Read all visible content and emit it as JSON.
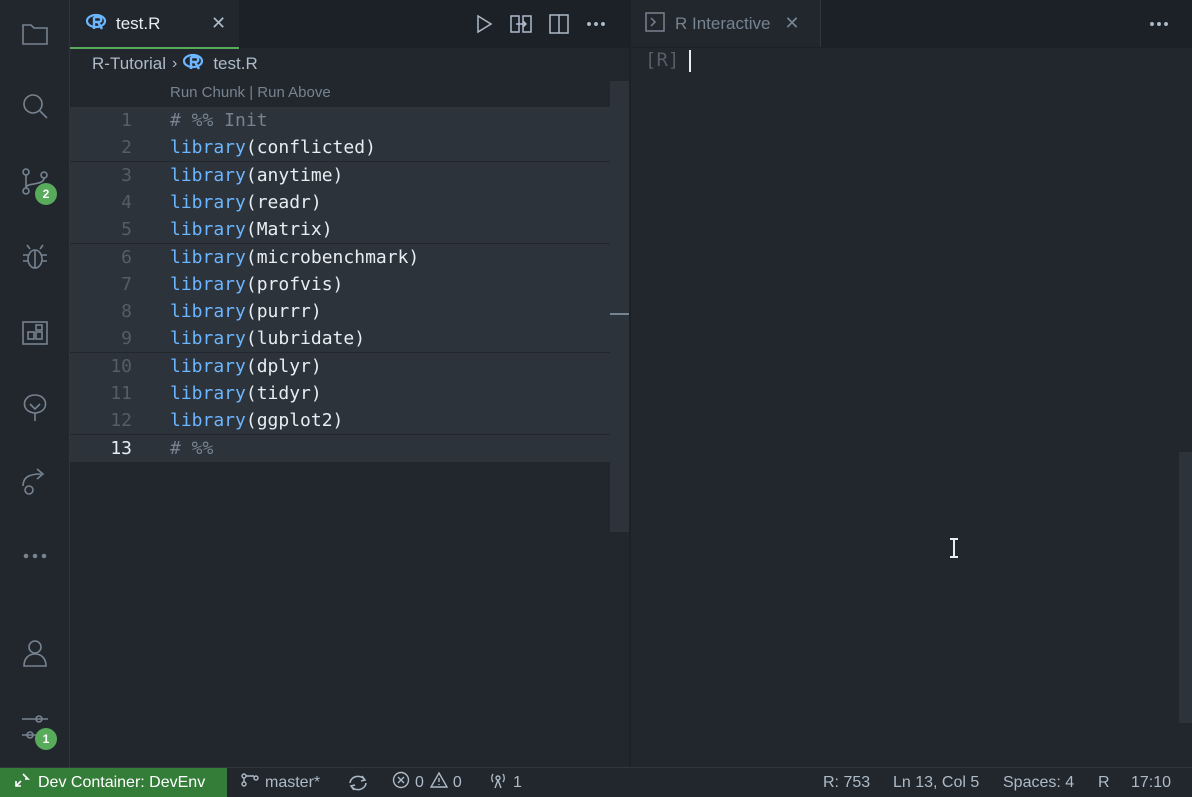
{
  "activity_bar": {
    "items": [
      {
        "icon": "files-icon"
      },
      {
        "icon": "search-icon"
      },
      {
        "icon": "source-control-icon",
        "badge": "2"
      },
      {
        "icon": "debug-icon"
      },
      {
        "icon": "extensions-icon"
      },
      {
        "icon": "tree-icon"
      },
      {
        "icon": "remote-explorer-icon"
      },
      {
        "icon": "more-icon"
      }
    ],
    "bottom": [
      {
        "icon": "account-icon"
      },
      {
        "icon": "settings-icon",
        "badge": "1"
      }
    ]
  },
  "editor": {
    "tab_label": "test.R",
    "breadcrumb": [
      "R-Tutorial",
      "test.R"
    ],
    "codelens": "Run Chunk | Run Above",
    "lines": [
      {
        "num": "1",
        "kw": "",
        "rest": "# %% Init"
      },
      {
        "num": "2",
        "kw": "library",
        "rest": "(conflicted)"
      },
      {
        "num": "3",
        "kw": "library",
        "rest": "(anytime)"
      },
      {
        "num": "4",
        "kw": "library",
        "rest": "(readr)"
      },
      {
        "num": "5",
        "kw": "library",
        "rest": "(Matrix)"
      },
      {
        "num": "6",
        "kw": "library",
        "rest": "(microbenchmark)"
      },
      {
        "num": "7",
        "kw": "library",
        "rest": "(profvis)"
      },
      {
        "num": "8",
        "kw": "library",
        "rest": "(purrr)"
      },
      {
        "num": "9",
        "kw": "library",
        "rest": "(lubridate)"
      },
      {
        "num": "10",
        "kw": "library",
        "rest": "(dplyr)"
      },
      {
        "num": "11",
        "kw": "library",
        "rest": "(tidyr)"
      },
      {
        "num": "12",
        "kw": "library",
        "rest": "(ggplot2)"
      },
      {
        "num": "13",
        "kw": "",
        "rest": "# %%"
      }
    ]
  },
  "panel": {
    "tab_label": "R Interactive",
    "prompt": "[R]"
  },
  "status_bar": {
    "remote": "Dev Container: DevEnv",
    "branch": "master*",
    "errors": "0",
    "warnings": "0",
    "ports": "1",
    "r_session": "R: 753",
    "position": "Ln 13, Col 5",
    "spaces": "Spaces: 4",
    "language": "R",
    "time": "17:10"
  },
  "colors": {
    "accent": "#57ab5a",
    "remote_bg": "#347d39",
    "keyword": "#6cb6ff"
  }
}
